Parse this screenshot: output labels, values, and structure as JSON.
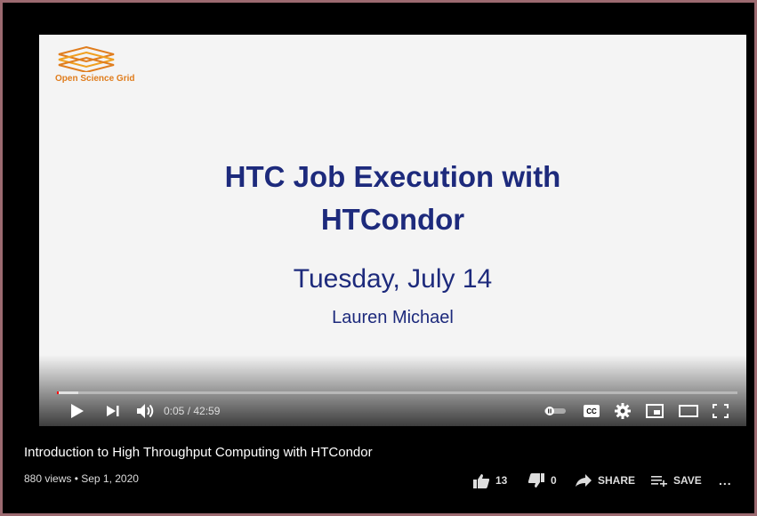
{
  "slide": {
    "logo_text": "Open Science Grid",
    "title_line1": "HTC Job Execution with",
    "title_line2": "HTCondor",
    "date": "Tuesday, July 14",
    "author": "Lauren Michael"
  },
  "player": {
    "time": "0:05 / 42:59",
    "progress_fraction": 0.002,
    "controls": [
      "play-icon",
      "next-icon",
      "volume-icon",
      "autoplay-toggle",
      "captions-icon",
      "settings-icon",
      "miniplayer-icon",
      "theater-icon",
      "fullscreen-icon"
    ],
    "cc_label": "CC"
  },
  "video": {
    "title": "Introduction to High Throughput Computing with HTCondor",
    "views_date": "880 views • Sep 1, 2020",
    "likes": "13",
    "dislikes": "0",
    "share_label": "SHARE",
    "save_label": "SAVE",
    "more_label": "..."
  },
  "colors": {
    "slide_text": "#1d2a7c",
    "logo_orange": "#e07d1d",
    "progress_red": "#ff0000",
    "border": "#9c6a70"
  }
}
